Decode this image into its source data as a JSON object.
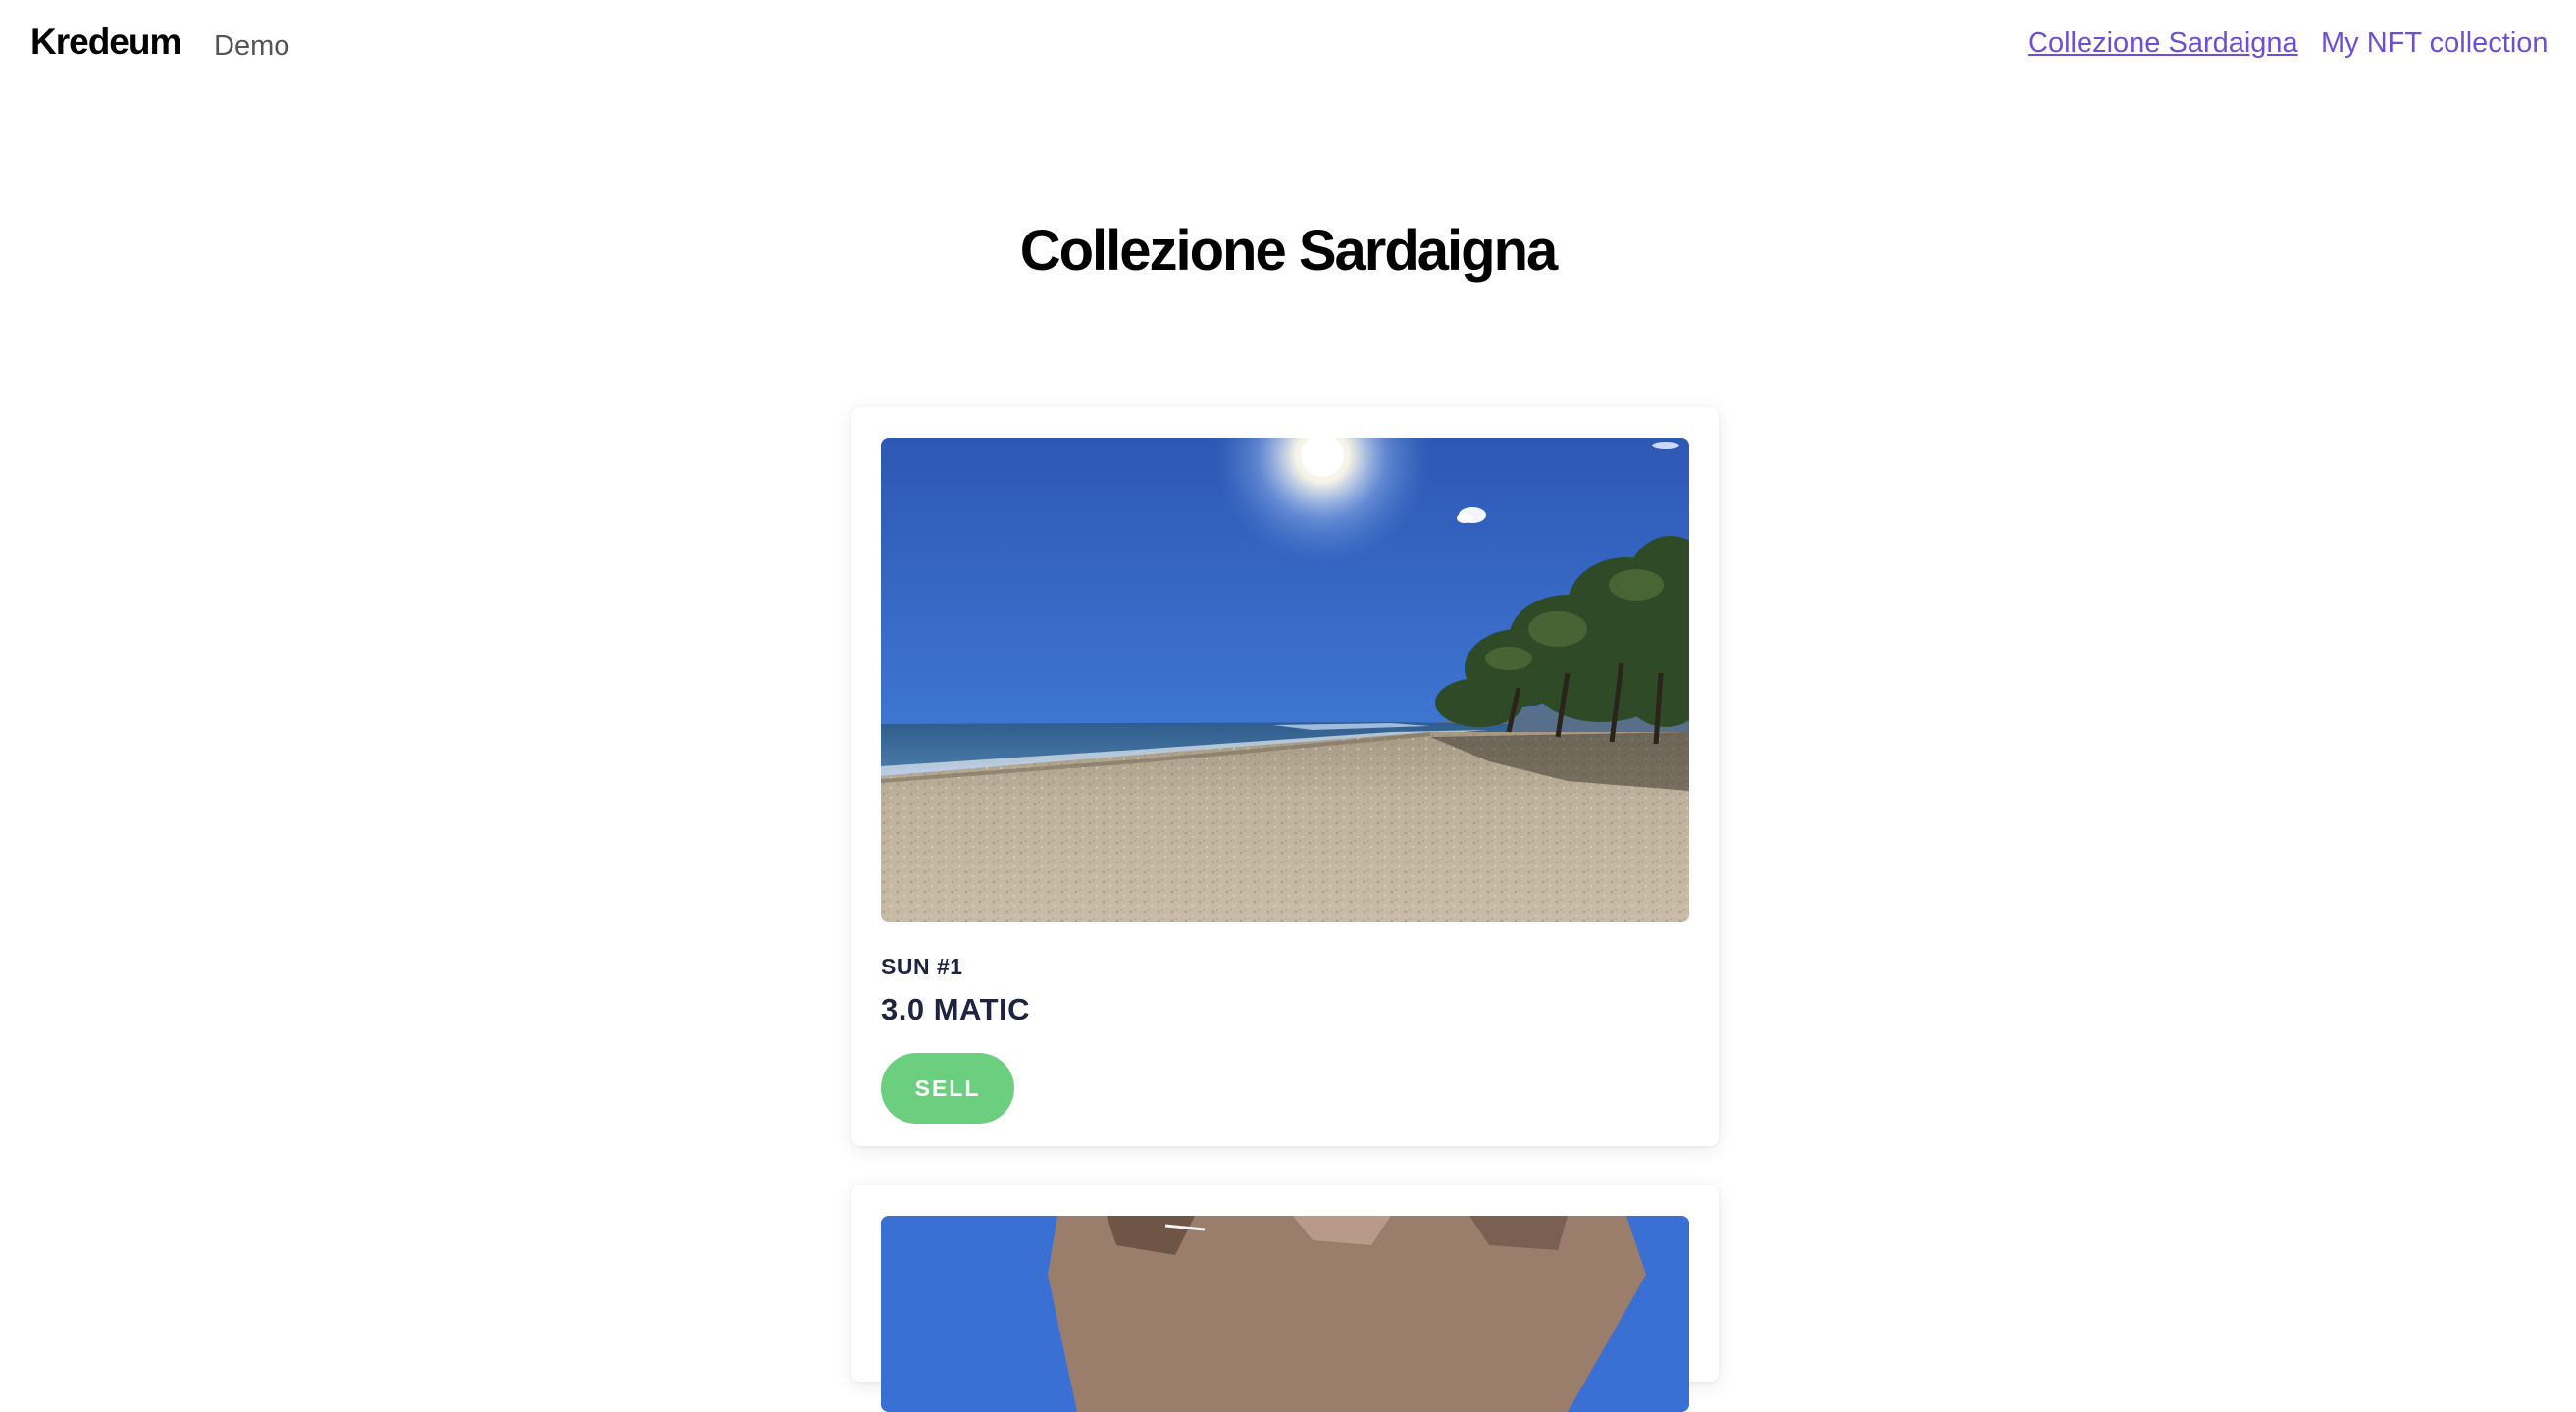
{
  "header": {
    "brand": "Kredeum",
    "subtitle": "Demo",
    "nav": [
      {
        "label": "Collezione Sardaigna",
        "current": true
      },
      {
        "label": "My NFT collection",
        "current": false
      }
    ]
  },
  "page": {
    "title": "Collezione Sardaigna"
  },
  "cards": [
    {
      "name": "SUN #1",
      "price": "3.0 MATIC",
      "button": "SELL",
      "image": "beach-photo"
    },
    {
      "image": "rock-photo"
    }
  ],
  "colors": {
    "link": "#6f4ed6",
    "sell_button": "#6ccf7f",
    "card_text": "#1e2440"
  }
}
